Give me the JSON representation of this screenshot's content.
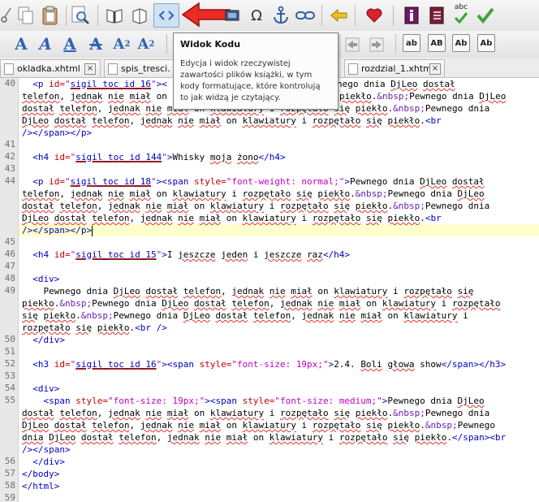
{
  "toolbar": {
    "tooltip": {
      "title": "Widok Kodu",
      "body": "Edycja i widok rzeczywistej\nzawartości plików książki, w tym\nkody formatujące, które kontrolują\nto jak widzą je czytający."
    },
    "omega": "Ω",
    "spell_label": "abc",
    "heading_buttons": [
      "ab",
      "AB",
      "Ab"
    ],
    "sub": "2",
    "sup": "2"
  },
  "tabs": [
    {
      "label": "okladka.xhtml"
    },
    {
      "label": "spis_tresci."
    },
    {
      "label": "rozdzial_1.xhtml"
    }
  ],
  "close_glyph": "×",
  "editor": {
    "line_numbers": [
      "40",
      "",
      "",
      "",
      "41",
      "42",
      "43",
      "44",
      "",
      "",
      "",
      "",
      "45",
      "46",
      "47",
      "48",
      "49",
      "",
      "",
      "",
      "50",
      "51",
      "52",
      "53",
      "54",
      "55",
      "",
      "",
      "",
      "",
      "56",
      "57",
      "58",
      "59"
    ]
  }
}
